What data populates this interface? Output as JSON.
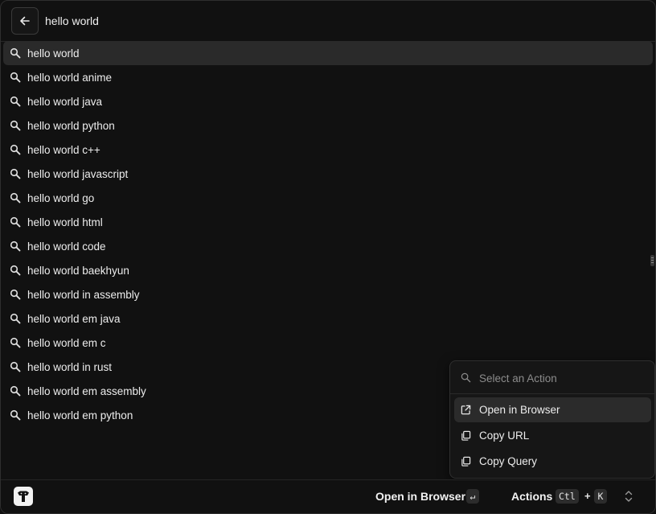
{
  "search": {
    "query": "hello world"
  },
  "results": [
    {
      "label": "hello world"
    },
    {
      "label": "hello world anime"
    },
    {
      "label": "hello world java"
    },
    {
      "label": "hello world python"
    },
    {
      "label": "hello world c++"
    },
    {
      "label": "hello world javascript"
    },
    {
      "label": "hello world go"
    },
    {
      "label": "hello world html"
    },
    {
      "label": "hello world code"
    },
    {
      "label": "hello world baekhyun"
    },
    {
      "label": "hello world in assembly"
    },
    {
      "label": "hello world em java"
    },
    {
      "label": "hello world em c"
    },
    {
      "label": "hello world in rust"
    },
    {
      "label": "hello world em assembly"
    },
    {
      "label": "hello world em python"
    }
  ],
  "action_panel": {
    "search_placeholder": "Select an Action",
    "items": [
      {
        "label": "Open in Browser",
        "icon": "open-external-icon"
      },
      {
        "label": "Copy URL",
        "icon": "copy-icon"
      },
      {
        "label": "Copy Query",
        "icon": "copy-icon"
      }
    ]
  },
  "footer": {
    "primary_action": "Open in Browser",
    "primary_key": "↵",
    "actions_label": "Actions",
    "actions_key_1": "Ctl",
    "actions_plus": "+",
    "actions_key_2": "K"
  },
  "colors": {
    "background": "#111111",
    "selected_row": "#2a2a2a",
    "text": "#ededed",
    "muted": "#8c8c8c"
  }
}
